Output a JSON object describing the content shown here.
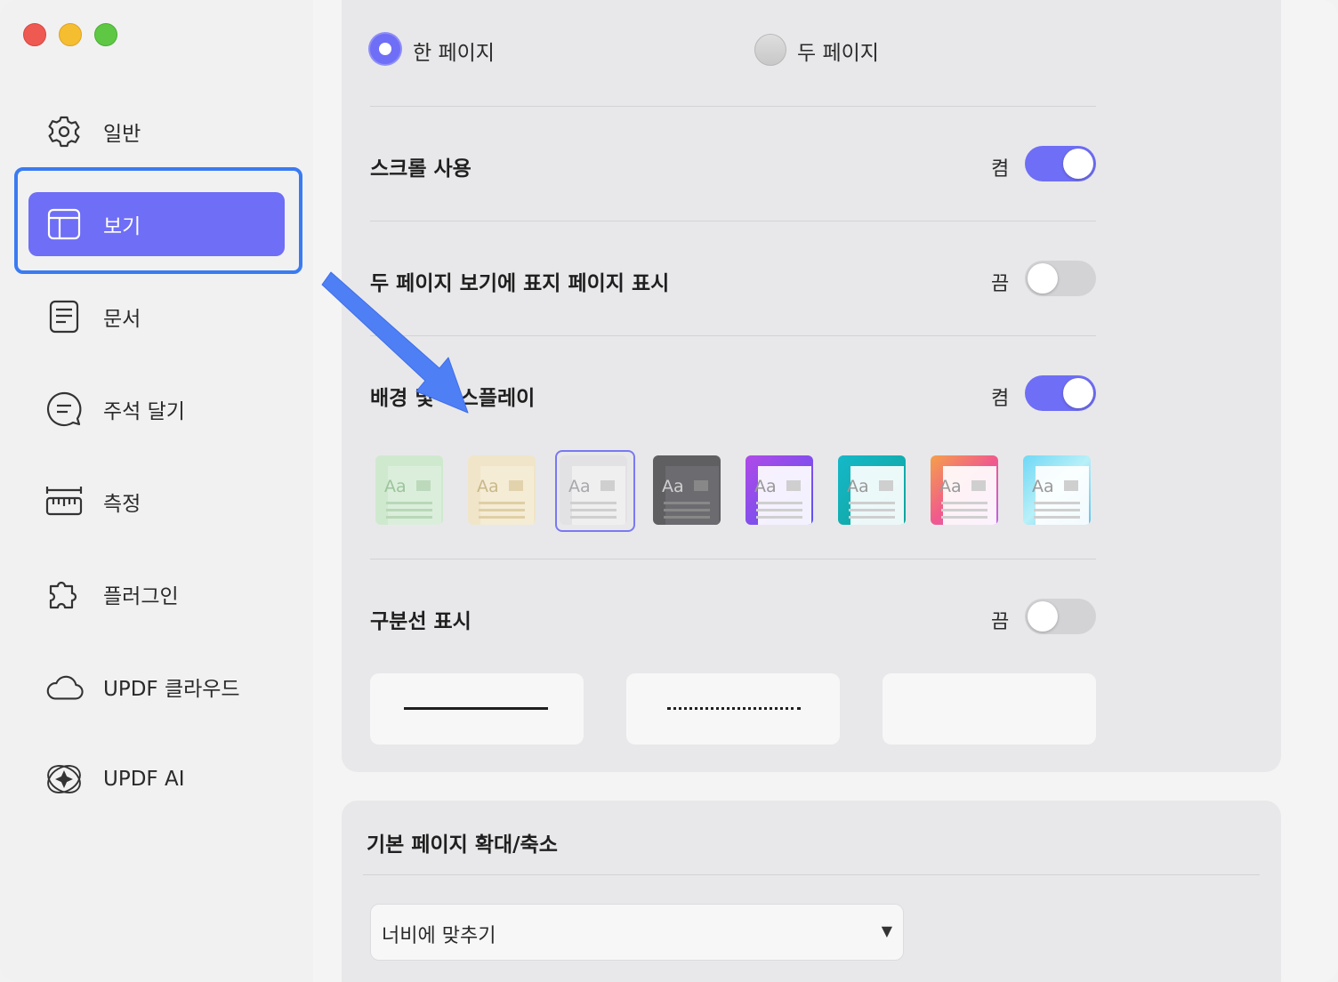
{
  "sidebar": {
    "items": [
      {
        "label": "일반",
        "icon": "gear-icon"
      },
      {
        "label": "보기",
        "icon": "layout-icon",
        "active": true
      },
      {
        "label": "문서",
        "icon": "document-icon"
      },
      {
        "label": "주석 달기",
        "icon": "comment-icon"
      },
      {
        "label": "측정",
        "icon": "ruler-icon"
      },
      {
        "label": "플러그인",
        "icon": "puzzle-icon"
      },
      {
        "label": "UPDF 클라우드",
        "icon": "cloud-icon"
      },
      {
        "label": "UPDF AI",
        "icon": "ai-icon"
      }
    ]
  },
  "view": {
    "page_mode": {
      "single_label": "한 페이지",
      "double_label": "두 페이지",
      "selected": "single"
    },
    "scroll": {
      "label": "스크롤 사용",
      "state": "켬",
      "on": true
    },
    "cover": {
      "label": "두 페이지 보기에 표지 페이지 표시",
      "state": "끔",
      "on": false
    },
    "background": {
      "label": "배경 및 디스플레이",
      "state": "켬",
      "on": true,
      "selected_theme_index": 2,
      "themes": [
        {
          "name": "green",
          "sample": "Aa"
        },
        {
          "name": "beige",
          "sample": "Aa"
        },
        {
          "name": "gray",
          "sample": "Aa"
        },
        {
          "name": "dark",
          "sample": "Aa"
        },
        {
          "name": "purple",
          "sample": "Aa"
        },
        {
          "name": "teal",
          "sample": "Aa"
        },
        {
          "name": "sunset",
          "sample": "Aa"
        },
        {
          "name": "sky",
          "sample": "Aa"
        }
      ]
    },
    "divider": {
      "label": "구분선 표시",
      "state": "끔",
      "on": false,
      "styles": [
        "solid",
        "dotted",
        "dash-dot"
      ]
    }
  },
  "zoom": {
    "title": "기본 페이지 확대/축소",
    "selected": "너비에 맞추기"
  },
  "colors": {
    "accent": "#6f6ef6",
    "focus": "#3a7bf2",
    "annotation_arrow": "#4f7ff5"
  }
}
